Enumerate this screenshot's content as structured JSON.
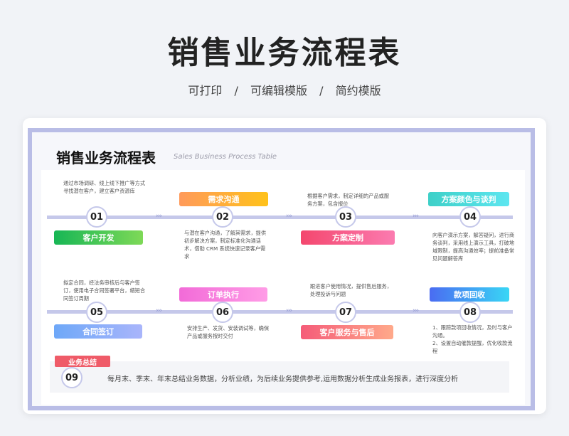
{
  "header": {
    "title": "销售业务流程表",
    "links": [
      "可打印",
      "可编辑模版",
      "简约模版"
    ],
    "separator": "/"
  },
  "doc": {
    "title": "销售业务流程表",
    "subtitle": "Sales Business Process Table"
  },
  "chevron": "›››",
  "steps": [
    {
      "num": "01",
      "label": "客户开发",
      "desc": "通过市场调研、线上线下推广等方式寻找潜在客户，建立客户资源库",
      "color": "linear-gradient(90deg,#17b655,#7ed957)"
    },
    {
      "num": "02",
      "label": "需求沟通",
      "desc": "与潜在客户沟通，了解其需求，提供初步解决方案，制定标准化沟通话术，借助 CRM 系统快速记录客户需求",
      "color": "linear-gradient(90deg,#ff9a5a,#ffc21a)"
    },
    {
      "num": "03",
      "label": "方案定制",
      "desc": "根据客户需求，制定详细的产品或服务方案，包含报价",
      "color": "linear-gradient(90deg,#f4476e,#fb7bb0)"
    },
    {
      "num": "04",
      "label": "方案颜色与谈判",
      "desc": "向客户演示方案，解答疑问，进行商务谈判，采用线上演示工具，打破地域限制，提高沟通效率；提前准备常见问题解答库",
      "color": "linear-gradient(90deg,#3ed0c8,#5de6f0)"
    },
    {
      "num": "05",
      "label": "合同签订",
      "desc": "拟定合同，经法务审核后与客户签订，使用电子合同签署平台，缩短合同签订周期",
      "color": "linear-gradient(90deg,#6ea8f8,#a9b5fb)"
    },
    {
      "num": "06",
      "label": "订单执行",
      "desc": "安排生产、发货、安装调试等，确保产品或服务按时交付",
      "color": "linear-gradient(90deg,#f26bd8,#ff9ce6)"
    },
    {
      "num": "07",
      "label": "客户服务与售后",
      "desc": "跟进客户使用情况，提供售后服务，处理投诉与问题",
      "color": "linear-gradient(90deg,#f55c79,#ffa98a)"
    },
    {
      "num": "08",
      "label": "款项回收",
      "desc": "1、跟踪款项回收情况，及时与客户沟通。\n2、设置自动催款提醒，优化收款流程",
      "color": "linear-gradient(90deg,#4a6cf2,#39d6f5)"
    }
  ],
  "summary": {
    "tag": "业务总结",
    "num": "09",
    "text": "每月末、季末、年末总结业务数据，分析业绩，为后续业务提供参考,运用数据分析生成业务报表，进行深度分析"
  }
}
